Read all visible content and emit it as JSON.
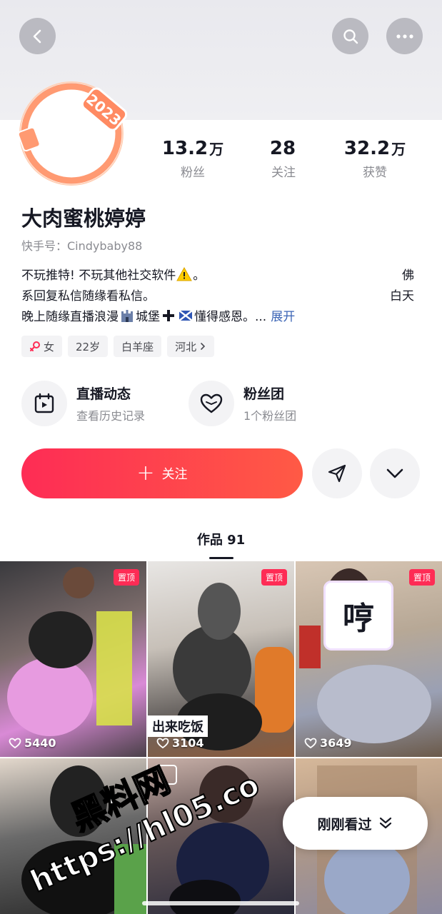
{
  "stats": [
    {
      "num": "13.2",
      "unit": "万",
      "label": "粉丝"
    },
    {
      "num": "28",
      "unit": "",
      "label": "关注"
    },
    {
      "num": "32.2",
      "unit": "万",
      "label": "获赞"
    }
  ],
  "profile": {
    "name": "大肉蜜桃婷婷",
    "account": "快手号：Cindybaby88",
    "avatar_badge": "2023"
  },
  "bio": {
    "line1": "不玩推特! 不玩其他社交软件",
    "line1_end": "。",
    "line1_right": "佛",
    "line2": "系回复私信随缘看私信。",
    "line2_right": "白天",
    "line3_a": "晚上随缘直播浪漫",
    "line3_b": "城堡",
    "line3_c": "懂得感恩。...",
    "expand": "展开"
  },
  "tags": {
    "gender": "女",
    "age": "22岁",
    "zodiac": "白羊座",
    "location": "河北"
  },
  "features": {
    "live": {
      "title": "直播动态",
      "sub": "查看历史记录"
    },
    "fans": {
      "title": "粉丝团",
      "sub": "1个粉丝团"
    }
  },
  "actions": {
    "follow_label": "关注"
  },
  "works_tab": "作品 91",
  "videos": [
    {
      "pinned": "置顶",
      "likes": "5440",
      "caption": ""
    },
    {
      "pinned": "置顶",
      "likes": "3104",
      "caption": "出来吃饭"
    },
    {
      "pinned": "置顶",
      "likes": "3649",
      "caption": "",
      "sticker": "哼"
    },
    {
      "pinned": "",
      "likes": "",
      "caption": ""
    },
    {
      "pinned": "",
      "likes": "",
      "caption": ""
    },
    {
      "pinned": "",
      "likes": "",
      "caption": ""
    }
  ],
  "watermark": {
    "line1": "黑料网",
    "line2": "https://hl05.co"
  },
  "recent_pill": "刚刚看过",
  "colors": {
    "accent": "#fe2c55",
    "link": "#3b64b5",
    "muted": "#8a8b91"
  }
}
